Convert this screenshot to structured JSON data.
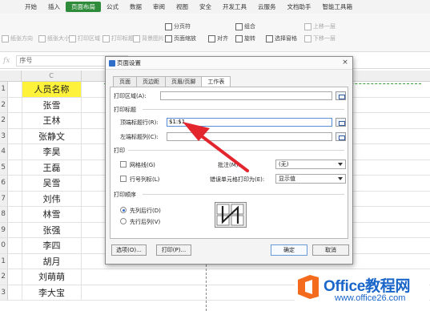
{
  "menu": [
    "开始",
    "插入",
    "页面布局",
    "公式",
    "数据",
    "审阅",
    "视图",
    "安全",
    "开发工具",
    "云服务",
    "文档助手",
    "智能工具箱"
  ],
  "menu_active": "页面布局",
  "toolbar": {
    "margin": "纸张方向",
    "size": "纸张大小",
    "print_area": "打印区域",
    "print_titles": "打印标题",
    "background": "背景图片",
    "page_break": "分页符",
    "page_zoom": "页面缩放",
    "align": "对齐",
    "group": "组合",
    "rotate": "旋转",
    "selection_pane": "选择窗格",
    "bring_forward": "上移一层",
    "send_backward": "下移一层"
  },
  "formula_bar": {
    "fx": "fx",
    "namebox": "序号"
  },
  "column_header": "C",
  "rows": [
    {
      "num": "1",
      "name": "人员名称",
      "header": true
    },
    {
      "num": "2",
      "name": "张雪"
    },
    {
      "num": "2",
      "name": "王林"
    },
    {
      "num": "3",
      "name": "张静文"
    },
    {
      "num": "4",
      "name": "李昊"
    },
    {
      "num": "5",
      "name": "王磊"
    },
    {
      "num": "6",
      "name": "吴雪"
    },
    {
      "num": "7",
      "name": "刘伟"
    },
    {
      "num": "8",
      "name": "林雪"
    },
    {
      "num": "9",
      "name": "张强"
    },
    {
      "num": "0",
      "name": "李四"
    },
    {
      "num": "1",
      "name": "胡月"
    },
    {
      "num": "2",
      "name": "刘萌萌"
    },
    {
      "num": "3",
      "name": "李大宝"
    }
  ],
  "dialog": {
    "title": "页面设置",
    "close": "×",
    "tabs": [
      "页面",
      "页边距",
      "页眉/页脚",
      "工作表"
    ],
    "active_tab": "工作表",
    "print_area_label": "打印区域(A):",
    "print_titles_label": "打印标题",
    "top_rows_label": "顶端标题行(R):",
    "top_rows_value": "$1:$1",
    "left_cols_label": "左端标题列(C):",
    "print_label": "打印",
    "gridlines_label": "网格线(G)",
    "rowcol_label": "行号列标(L)",
    "comments_label": "批注(M):",
    "comments_value": "(无)",
    "errors_label": "错误单元格打印为(E):",
    "errors_value": "显示值",
    "order_label": "打印顺序",
    "down_then_over": "先列后行(D)",
    "over_then_down": "先行后列(V)",
    "options_btn": "选项(O)...",
    "print_btn": "打印(P)...",
    "ok_btn": "确定",
    "cancel_btn": "取消"
  },
  "watermark": {
    "title": "Office教程网",
    "url": "www.office26.com"
  },
  "colors": {
    "accent": "#2e8b3a",
    "header_fill": "#fff23a",
    "arrow": "#e3252e",
    "logo_blue": "#1a66c9",
    "logo_orange": "#f46b1d"
  }
}
